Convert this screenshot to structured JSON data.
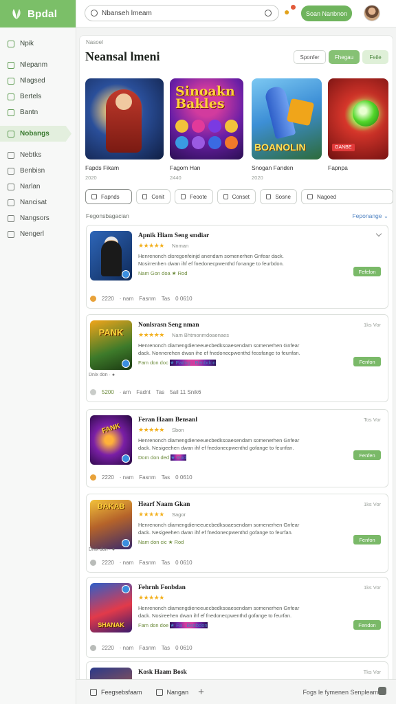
{
  "brand": {
    "name": "Bpdal"
  },
  "sidebar": {
    "items": [
      {
        "label": "Npik",
        "group": "green"
      },
      {
        "label": "Nlepanm",
        "group": "green"
      },
      {
        "label": "Nlagsed",
        "group": "green"
      },
      {
        "label": "Bertels",
        "group": "green"
      },
      {
        "label": "Bantn",
        "group": "green"
      },
      {
        "label": "Nobangs",
        "group": "active"
      },
      {
        "label": "Nebtks",
        "group": "gray"
      },
      {
        "label": "Benbisn",
        "group": "gray"
      },
      {
        "label": "Narlan",
        "group": "gray"
      },
      {
        "label": "Nancisat",
        "group": "gray"
      },
      {
        "label": "Nangsors",
        "group": "gray"
      },
      {
        "label": "Nengerl",
        "group": "gray"
      }
    ]
  },
  "topbar": {
    "search_value": "Nbanseh lmeam",
    "cta_label": "Soan Nanbnon"
  },
  "main": {
    "breadcrumb": "Nasoel",
    "title": "Neansal lmeni",
    "segments": [
      "Sponfer",
      "Fhegau",
      "Feile"
    ],
    "featured": [
      {
        "name": "Fapds Fikam",
        "meta": "2020",
        "art": "Sinoakn Bakles"
      },
      {
        "name": "Fagom Han",
        "meta": "2440",
        "art": ""
      },
      {
        "name": "Snogan Fanden",
        "meta": "2020",
        "art": "BOANOLIN"
      },
      {
        "name": "Fapnpa",
        "meta": "",
        "art": "GANBE"
      }
    ],
    "chips": [
      "Fapnds",
      "Conit",
      "Feoote",
      "Conset",
      "Sosne",
      "Nagoed"
    ],
    "section_label": "Fegonsbagacian",
    "sort_label": "Feponange"
  },
  "cards": [
    {
      "title": "Apnik Hiam Seng smdiar",
      "stars": "★★★★★",
      "rating_text": "Nnman",
      "desc": "Henrenonch disregonfeinjd anendam somenerhen Gnfear dack. Nosirrenhen dwan ihf ef fnedonecpwenthd fonange to feurbdon.",
      "tag1": "Nam Gon doa",
      "tag2": "★ Rod",
      "date": "",
      "install": "Fefelon",
      "stat1": "2220",
      "stat1b": "· nam",
      "stat2": "Fasnm",
      "stat3": "Tas",
      "stat4": "0 0610",
      "icon_label": "",
      "extra": ""
    },
    {
      "title": "Nonlsrasn Seng nman",
      "stars": "★★★★★",
      "rating_text": "Nam Bhtmonmdoaenaes",
      "desc": "Henrenonch diamengdieneeuecbedksoaesendam somenerhen Gnfear dack. Nonnerehen dwan ihe ef fnedonecpwenthd feosfange to feunfan.",
      "tag1": "Fam don doc",
      "tag2": "★ Fadng · Benbdon",
      "date": "1ks Vor",
      "install": "Fenfon",
      "stat1": "5200",
      "stat1b": "· arn",
      "stat2": "Fadnt",
      "stat3": "Tas",
      "stat4": "5ail 11 Snik6",
      "icon_label": "PANK",
      "extra": "Dnix don · ●"
    },
    {
      "title": "Feran Haam Bensanl",
      "stars": "★★★★★",
      "rating_text": "Sbon",
      "desc": "Henrenonch diamengdieneeuecbedksoaesendam somenerhen Gnfear dack. Nesigeehen dwan ihf ef fnedonecpwenthd gofange to feunfan.",
      "tag1": "Dom don ded",
      "tag2": "★ Rod",
      "date": "Tos Vor",
      "install": "Fenfen",
      "stat1": "2220",
      "stat1b": "· nam",
      "stat2": "Fasnm",
      "stat3": "Tas",
      "stat4": "0 0610",
      "icon_label": "FANK",
      "extra": ""
    },
    {
      "title": "Hearf Naam Gkan",
      "stars": "★★★★★",
      "rating_text": "Sagor",
      "desc": "Henrenonch diamengdieneeuecbedksoaesendam somenerhen Gnfear dack. Nesigeehen dwan ihf ef fnedonecpwenthd gofange to feurfan.",
      "tag1": "Nam don cic",
      "tag2": "★ Rod",
      "date": "1ks Vor",
      "install": "Fenfon",
      "stat1": "2220",
      "stat1b": "· nam",
      "stat2": "Fasnm",
      "stat3": "Tas",
      "stat4": "0 0610",
      "icon_label": "BAKAB",
      "extra": "Dnix don · ●"
    },
    {
      "title": "Fehrnh Fonbdan",
      "stars": "★★★★★",
      "rating_text": "",
      "desc": "Henrenonch diamengdieneeuecbedksoaesendam somenerhen Gnfear dack. Nosireehen dwan ihf ef fnedonecpwenthd gofange to feurfan.",
      "tag1": "Fam don doe",
      "tag2": "★ Fa · Benbdon",
      "date": "1ks Vor",
      "install": "Fendon",
      "stat1": "2220",
      "stat1b": "· nam",
      "stat2": "Fasnm",
      "stat3": "Tas",
      "stat4": "0 0610",
      "icon_label": "SHANAK",
      "extra": ""
    },
    {
      "title": "Kosk Haam Bosk",
      "stars": "",
      "rating_text": "",
      "desc": "",
      "tag1": "",
      "tag2": "",
      "date": "Tks Vor",
      "install": "",
      "stat1": "",
      "stat1b": "",
      "stat2": "",
      "stat3": "",
      "stat4": "",
      "icon_label": "",
      "extra": ""
    }
  ],
  "bottombar": {
    "item1": "Feegsebsfaam",
    "item2": "Nangan",
    "right": "Fogs le fymenen Senpleam"
  }
}
